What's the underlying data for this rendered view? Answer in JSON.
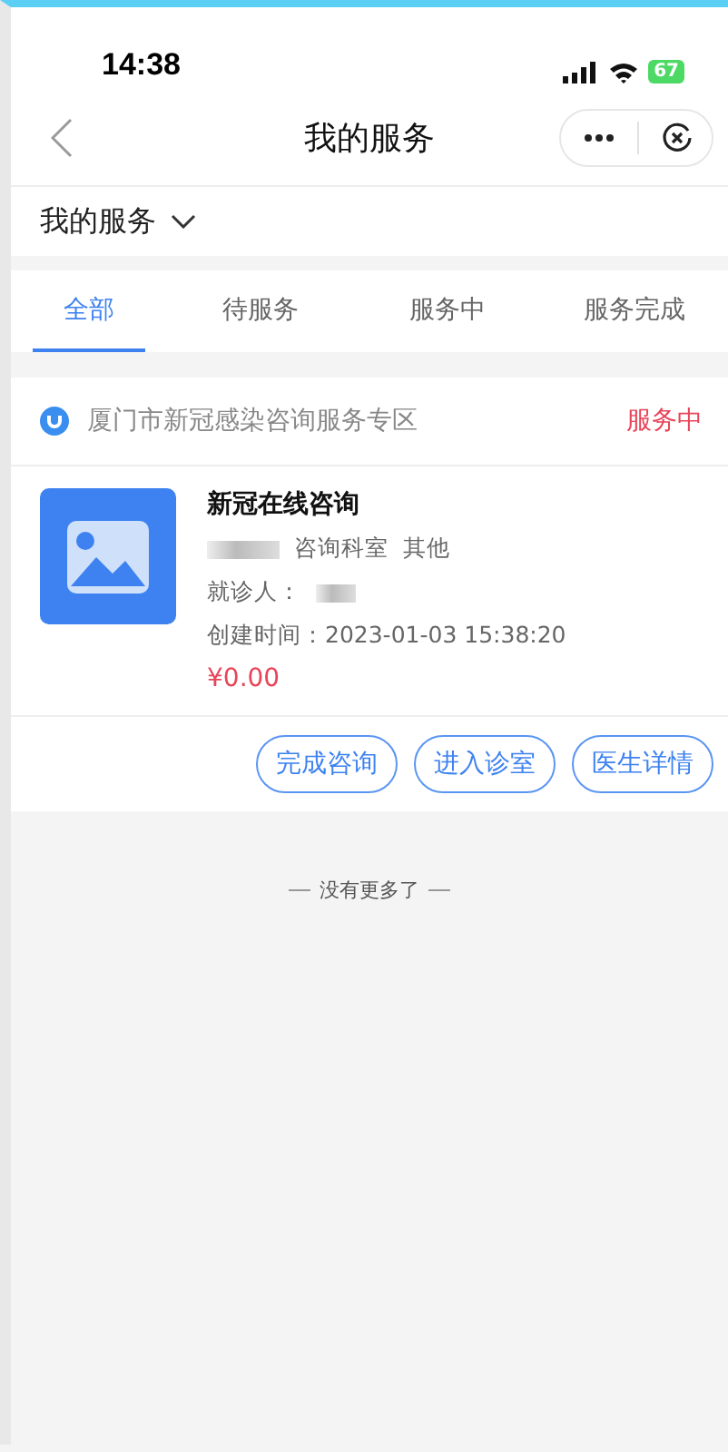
{
  "status_bar": {
    "time": "14:38",
    "battery": "67"
  },
  "nav": {
    "title": "我的服务"
  },
  "filter": {
    "label": "我的服务"
  },
  "tabs": [
    {
      "label": "全部",
      "selected": true
    },
    {
      "label": "待服务",
      "selected": false
    },
    {
      "label": "服务中",
      "selected": false
    },
    {
      "label": "服务完成",
      "selected": false
    }
  ],
  "orders": [
    {
      "zone": "厦门市新冠感染咨询服务专区",
      "status": "服务中",
      "title": "新冠在线咨询",
      "department": "咨询科室",
      "category": "其他",
      "patient_label": "就诊人：",
      "created": "创建时间：2023-01-03 15:38:20",
      "price": "¥0.00",
      "actions": [
        "完成咨询",
        "进入诊室",
        "医生详情"
      ]
    }
  ],
  "footer": "没有更多了"
}
